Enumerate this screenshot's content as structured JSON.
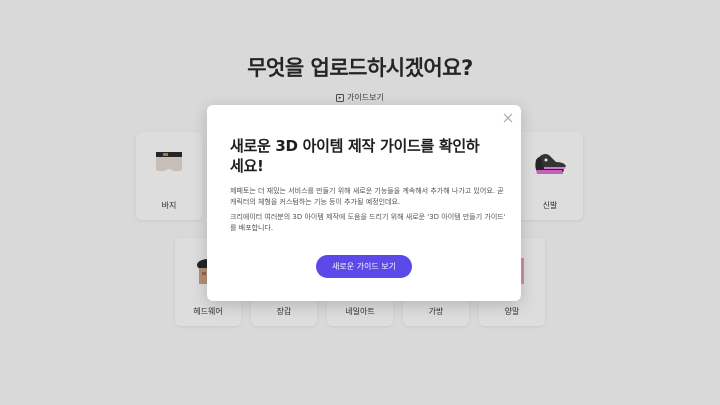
{
  "header": {
    "title": "무엇을 업로드하시겠어요?",
    "guide_link": "가이드보기"
  },
  "categories": [
    {
      "label": "바지",
      "icon": "pants-icon"
    },
    {
      "label": "신발",
      "icon": "sneaker-icon"
    },
    {
      "label": "헤드웨어",
      "icon": "headwear-icon"
    },
    {
      "label": "장갑",
      "icon": "glove-icon"
    },
    {
      "label": "네일아트",
      "icon": "nail-icon"
    },
    {
      "label": "가방",
      "icon": "bag-icon"
    },
    {
      "label": "양말",
      "icon": "sock-icon"
    }
  ],
  "modal": {
    "title": "새로운 3D 아이템 제작 가이드를 확인하세요!",
    "paragraph1": "제페토는 더 재밌는 서비스를 만들기 위해 새로운 기능들을 계속해서 추가해 나가고 있어요. 곧 캐릭터의 체형을 커스텀하는 기능 등이 추가될 예정인데요.",
    "paragraph2": "크리에이터 여러분의 3D 아이템 제작에 도움을 드리기 위해 새로운 '3D 아이템 만들기 가이드' 를 배포합니다.",
    "button_label": "새로운 가이드 보기",
    "accent_color": "#5b49e8"
  }
}
